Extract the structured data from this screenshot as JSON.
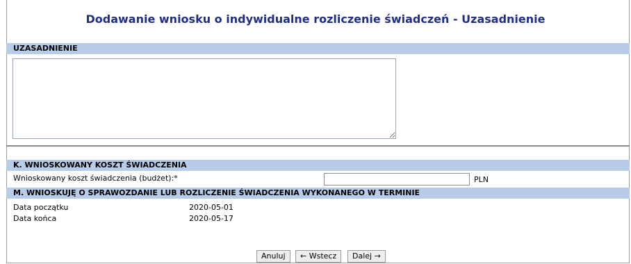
{
  "page": {
    "title": "Dodawanie wniosku o indywidualne rozliczenie świadczeń - Uzasadnienie"
  },
  "sections": {
    "uzasadnienie": {
      "header": "UZASADNIENIE",
      "textarea_value": ""
    },
    "k": {
      "header": "K. WNIOSKOWANY KOSZT ŚWIADCZENIA",
      "label": "Wnioskowany koszt świadczenia (budżet):*",
      "input_value": "",
      "unit": "PLN"
    },
    "m": {
      "header": "M. WNIOSKUJĘ O SPRAWOZDANIE LUB ROZLICZENIE ŚWIADCZENIA WYKONANEGO W TERMINIE",
      "start_label": "Data początku",
      "start_value": "2020-05-01",
      "end_label": "Data końca",
      "end_value": "2020-05-17"
    }
  },
  "buttons": {
    "cancel": "Anuluj",
    "back": "← Wstecz",
    "next": "Dalej →"
  }
}
